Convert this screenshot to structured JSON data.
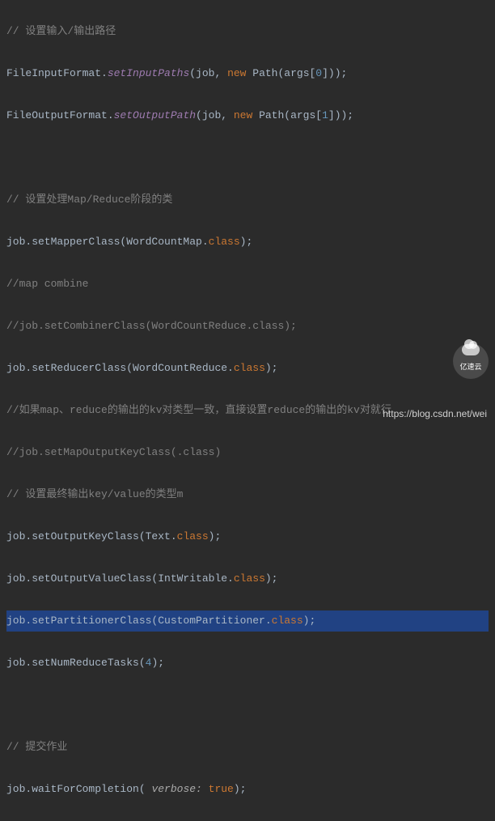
{
  "code": {
    "c1": "// 设置输入/输出路径",
    "l2a": "FileInputFormat.",
    "l2b": "setInputPaths",
    "l2c": "(job, ",
    "l2d": "new ",
    "l2e": "Path(args[",
    "l2f": "0",
    "l2g": "]));",
    "l3a": "FileOutputFormat.",
    "l3b": "setOutputPath",
    "l3c": "(job, ",
    "l3d": "new ",
    "l3e": "Path(args[",
    "l3f": "1",
    "l3g": "]));",
    "c5": "// 设置处理Map/Reduce阶段的类",
    "l6a": "job.setMapperClass(WordCountMap.",
    "l6b": "class",
    "l6c": ");",
    "c7": "//map combine",
    "c8": "//job.setCombinerClass(WordCountReduce.class);",
    "l9a": "job.setReducerClass(WordCountReduce.",
    "l9b": "class",
    "l9c": ");",
    "c10": "//如果map、reduce的输出的kv对类型一致，直接设置reduce的输出的kv对就行",
    "c11": "//job.setMapOutputKeyClass(.class)",
    "c12": "// 设置最终输出key/value的类型m",
    "l13a": "job.setOutputKeyClass(Text.",
    "l13b": "class",
    "l13c": ");",
    "l14a": "job.setOutputValueClass(IntWritable.",
    "l14b": "class",
    "l14c": ");",
    "l15a": "job.setPartitionerClass(CustomPartitioner.",
    "l15b": "class",
    "l15c": ");",
    "l16a": "job.setNumReduceTasks(",
    "l16b": "4",
    "l16c": ");",
    "c18": "// 提交作业",
    "l19a": "job.waitForCompletion( ",
    "l19b": "verbose: ",
    "l19c": "true",
    "l19d": ");"
  },
  "footer": "https://blog.csdn.net/wei",
  "watermark": "亿速云"
}
